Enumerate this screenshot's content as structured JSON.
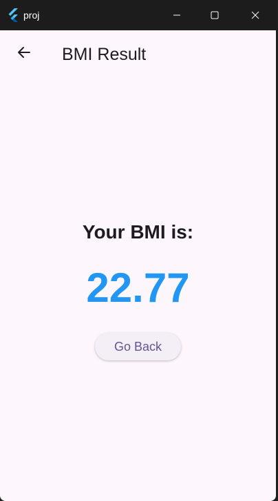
{
  "window": {
    "title": "proj",
    "icon": "flutter-logo-icon",
    "controls": [
      "minimize-icon",
      "maximize-icon",
      "close-icon"
    ]
  },
  "appbar": {
    "back_icon": "arrow-left-icon",
    "title": "BMI Result"
  },
  "result": {
    "heading": "Your BMI is:",
    "value": "22.77"
  },
  "actions": {
    "go_back_label": "Go Back"
  },
  "colors": {
    "background": "#fdf7fd",
    "value_color": "#2196f3",
    "button_text": "#65558f",
    "button_bg": "#f4eef7",
    "titlebar": "#1c1c1c"
  }
}
